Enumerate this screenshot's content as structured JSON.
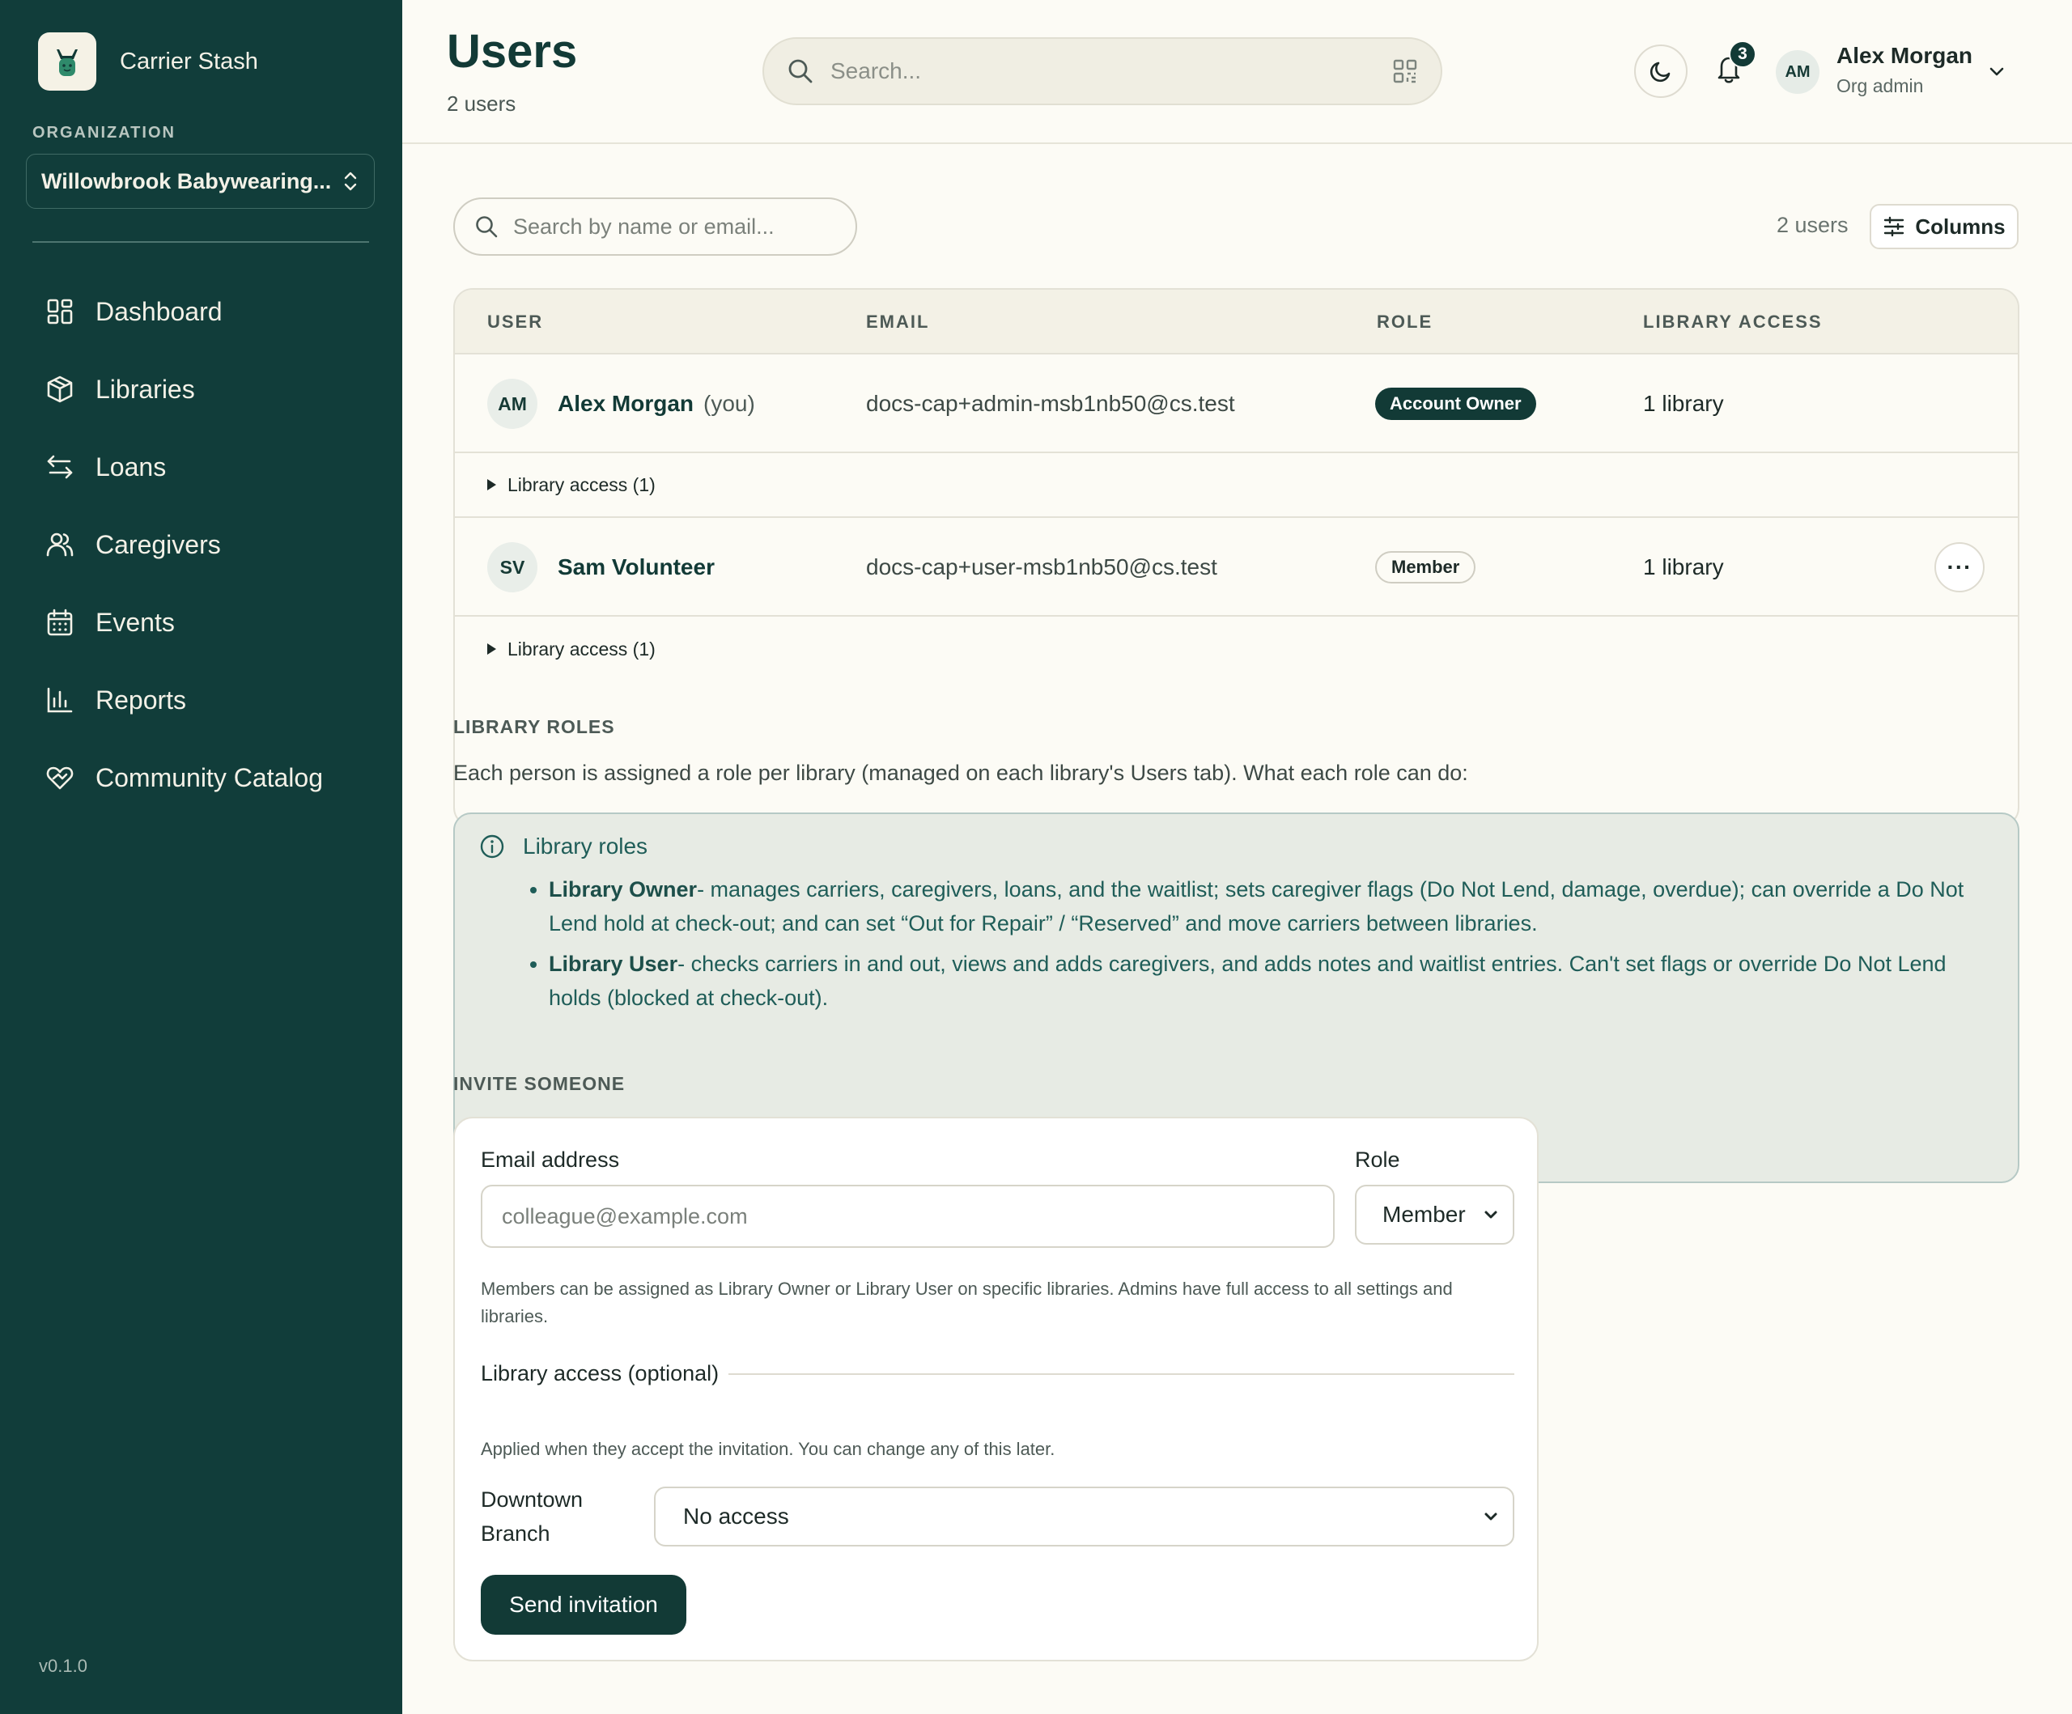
{
  "app": {
    "name": "Carrier Stash",
    "version": "v0.1.0"
  },
  "sidebar": {
    "org_label": "ORGANIZATION",
    "org_selected": "Willowbrook Babywearing...",
    "items": [
      {
        "label": "Dashboard",
        "icon": "dashboard-icon"
      },
      {
        "label": "Libraries",
        "icon": "box-icon"
      },
      {
        "label": "Loans",
        "icon": "arrows-icon"
      },
      {
        "label": "Caregivers",
        "icon": "people-icon"
      },
      {
        "label": "Events",
        "icon": "calendar-icon"
      },
      {
        "label": "Reports",
        "icon": "bar-chart-icon"
      },
      {
        "label": "Community Catalog",
        "icon": "heart-hands-icon"
      }
    ]
  },
  "header": {
    "title": "Users",
    "subtitle": "2 users",
    "search_placeholder": "Search...",
    "notification_count": "3",
    "user": {
      "initials": "AM",
      "name": "Alex Morgan",
      "role": "Org admin"
    }
  },
  "users_panel": {
    "search_placeholder": "Search by name or email...",
    "count": "2 users",
    "columns_label": "Columns",
    "headers": {
      "user": "USER",
      "email": "EMAIL",
      "role": "ROLE",
      "library_access": "LIBRARY ACCESS"
    },
    "rows": [
      {
        "initials": "AM",
        "name": "Alex Morgan",
        "you": "(you)",
        "email": "docs-cap+admin-msb1nb50@cs.test",
        "role": "Account Owner",
        "library_access": "1 library",
        "access_toggle": "Library access (1)"
      },
      {
        "initials": "SV",
        "name": "Sam Volunteer",
        "you": "",
        "email": "docs-cap+user-msb1nb50@cs.test",
        "role": "Member",
        "library_access": "1 library",
        "access_toggle": "Library access (1)",
        "more": "···"
      }
    ]
  },
  "library_roles": {
    "section_label": "LIBRARY ROLES",
    "intro": "Each person is assigned a role per library (managed on each library's Users tab). What each role can do:",
    "box_title": "Library roles",
    "owner_name": "Library Owner",
    "owner_desc": "- manages carriers, caregivers, loans, and the waitlist; sets caregiver flags (Do Not Lend, damage, overdue); can override a Do Not Lend hold at check-out; and can set “Out for Repair” / “Reserved” and move carriers between libraries.",
    "user_name": "Library User",
    "user_desc": "- checks carriers in and out, views and adds caregivers, and adds notes and waitlist entries. Can't set flags or override Do Not Lend holds (blocked at check-out)."
  },
  "invite": {
    "section_label": "INVITE SOMEONE",
    "email_label": "Email address",
    "email_placeholder": "colleague@example.com",
    "role_label": "Role",
    "role_value": "Member",
    "help": "Members can be assigned as Library Owner or Library User on specific libraries. Admins have full access to all settings and libraries.",
    "access_legend": "Library access (optional)",
    "applied_note": "Applied when they accept the invitation. You can change any of this later.",
    "branch_label": "Downtown Branch",
    "branch_access": "No access",
    "send_label": "Send invitation"
  },
  "colors": {
    "sidebar_bg": "#113d3a",
    "accent": "#123a36",
    "info_bg": "#e7ebe4",
    "page_bg": "#fcfbf5"
  }
}
